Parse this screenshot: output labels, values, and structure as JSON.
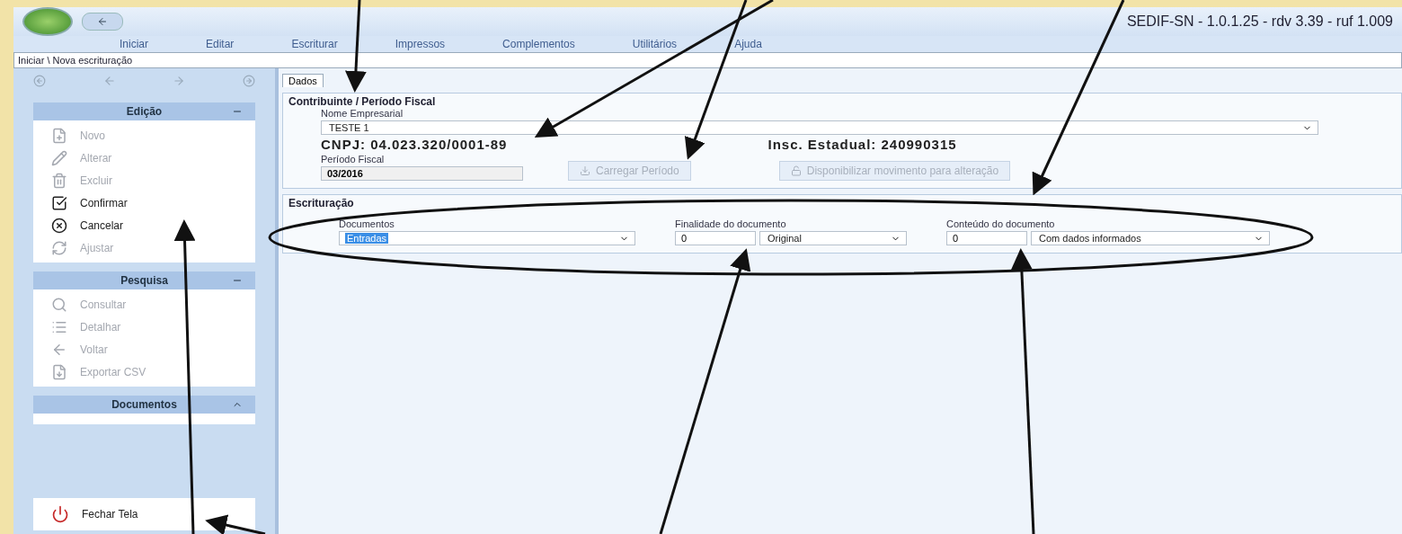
{
  "window": {
    "title": "SEDIF-SN - 1.0.1.25 - rdv 3.39 - ruf 1.009"
  },
  "menu": [
    {
      "label": "Iniciar"
    },
    {
      "label": "Editar"
    },
    {
      "label": "Escriturar"
    },
    {
      "label": "Impressos"
    },
    {
      "label": "Complementos"
    },
    {
      "label": "Utilitários"
    },
    {
      "label": "Ajuda"
    }
  ],
  "breadcrumb": "Iniciar \\ Nova escrituração",
  "sidebar": {
    "sections": [
      {
        "title": "Edição",
        "items": [
          {
            "label": "Novo",
            "disabled": true
          },
          {
            "label": "Alterar",
            "disabled": true
          },
          {
            "label": "Excluir",
            "disabled": true
          },
          {
            "label": "Confirmar",
            "disabled": false
          },
          {
            "label": "Cancelar",
            "disabled": false
          },
          {
            "label": "Ajustar",
            "disabled": true
          }
        ]
      },
      {
        "title": "Pesquisa",
        "items": [
          {
            "label": "Consultar",
            "disabled": true
          },
          {
            "label": "Detalhar",
            "disabled": true
          },
          {
            "label": "Voltar",
            "disabled": true
          },
          {
            "label": "Exportar CSV",
            "disabled": true
          }
        ]
      },
      {
        "title": "Documentos"
      }
    ],
    "footer": {
      "label": "Fechar Tela",
      "disabled": false
    }
  },
  "tab": {
    "label": "Dados"
  },
  "contribuinte": {
    "title": "Contribuinte / Período Fiscal",
    "name_label": "Nome Empresarial",
    "name_value": "TESTE 1",
    "cnpj": "CNPJ: 04.023.320/0001-89",
    "ie": "Insc. Estadual: 240990315",
    "period_label": "Período Fiscal",
    "period_value": "03/2016",
    "buttons": [
      {
        "label": "Carregar Período",
        "disabled": true
      },
      {
        "label": "Disponibilizar movimento para alteração",
        "disabled": true
      }
    ]
  },
  "escrituracao": {
    "title": "Escrituração",
    "documentos": {
      "label": "Documentos",
      "value": "Entradas"
    },
    "finalidade": {
      "label": "Finalidade do documento",
      "code": "0",
      "value": "Original"
    },
    "conteudo": {
      "label": "Conteúdo do documento",
      "code": "0",
      "value": "Com dados informados"
    }
  }
}
